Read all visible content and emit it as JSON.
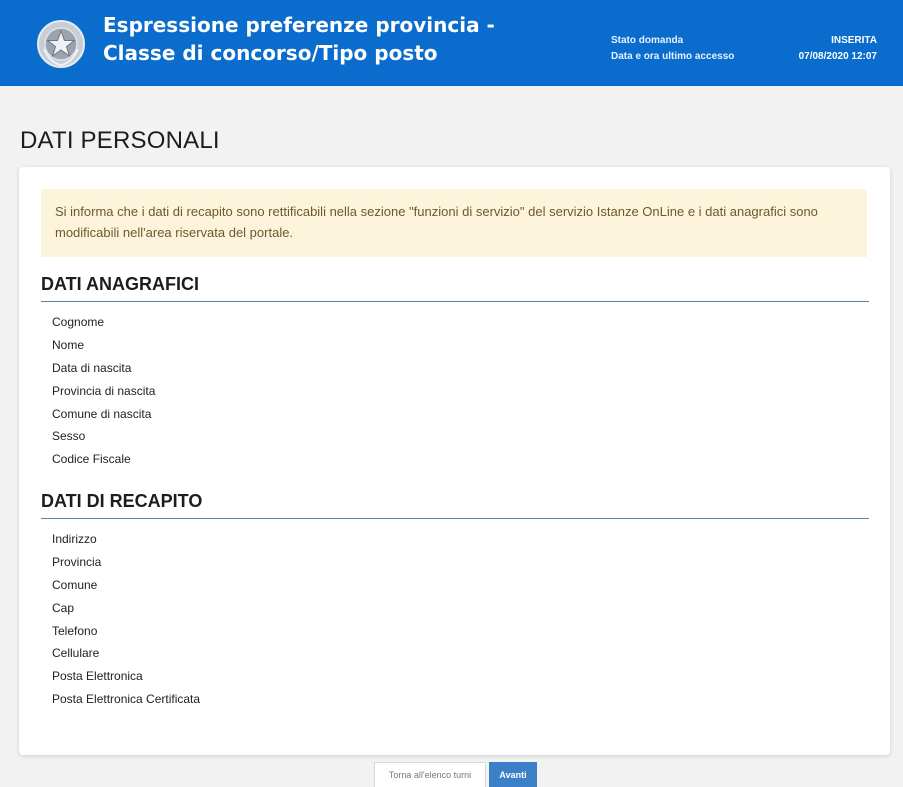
{
  "header": {
    "title": "Espressione preferenze provincia - Classe di concorso/Tipo posto",
    "emblem_icon": "italian-republic-emblem-icon",
    "status_label": "Stato domanda",
    "status_value": "INSERITA",
    "last_access_label": "Data e ora ultimo accesso",
    "last_access_value": "07/08/2020 12:07",
    "background_color": "#0a6ccd"
  },
  "page": {
    "title": "DATI PERSONALI"
  },
  "notice": {
    "text": "Si informa che i dati di recapito sono rettificabili nella sezione \"funzioni di servizio\" del servizio Istanze OnLine e i dati anagrafici sono modificabili nell'area riservata del portale.",
    "background_color": "#fdf4dc"
  },
  "dati_anagrafici": {
    "title": "DATI ANAGRAFICI",
    "fields": [
      "Cognome",
      "Nome",
      "Data di nascita",
      "Provincia di nascita",
      "Comune di nascita",
      "Sesso",
      "Codice Fiscale"
    ]
  },
  "dati_recapito": {
    "title": "DATI DI RECAPITO",
    "fields": [
      "Indirizzo",
      "Provincia",
      "Comune",
      "Cap",
      "Telefono",
      "Cellulare",
      "Posta Elettronica",
      "Posta Elettronica Certificata"
    ]
  },
  "buttons": {
    "back_label": "Torna all'elenco turni",
    "next_label": "Avanti",
    "next_color": "#3b7fc8"
  }
}
